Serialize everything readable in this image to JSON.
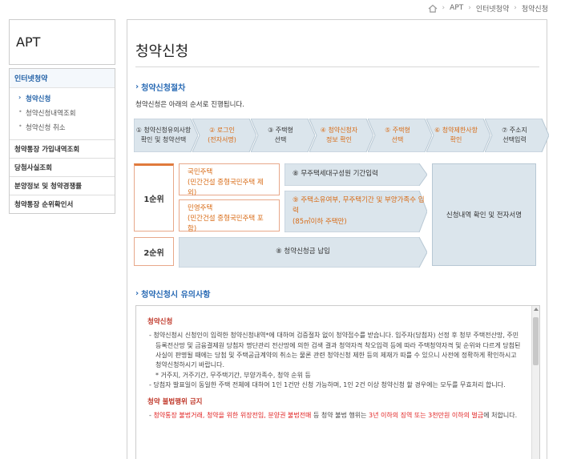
{
  "breadcrumb": {
    "items": [
      "APT",
      "인터넷청약",
      "청약신청"
    ]
  },
  "sidebar": {
    "title": "APT",
    "group_head": "인터넷청약",
    "sub_items": [
      {
        "label": "청약신청",
        "active": true
      },
      {
        "label": "청약신청내역조회",
        "active": false
      },
      {
        "label": "청약신청 취소",
        "active": false
      }
    ],
    "items": [
      "청약통장 가입내역조회",
      "당첨사실조회",
      "분양정보 및 청약경쟁률",
      "청약통장 순위확인서"
    ]
  },
  "main": {
    "title": "청약신청",
    "procedure_heading": "청약신청절차",
    "intro": "청약신청은 아래의 순서로 진행됩니다.",
    "steps": [
      {
        "line1": "① 청약신청유의사항",
        "line2": "확인 및 청약선택",
        "style": "gray"
      },
      {
        "line1": "② 로그인",
        "line2": "(전자서명)",
        "style": "orange"
      },
      {
        "line1": "③ 주택형",
        "line2": "선택",
        "style": "gray"
      },
      {
        "line1": "④ 청약신청자",
        "line2": "정보 확인",
        "style": "orange"
      },
      {
        "line1": "⑤ 주택형",
        "line2": "선택",
        "style": "orange"
      },
      {
        "line1": "⑥ 청약제한사항",
        "line2": "확인",
        "style": "orange"
      },
      {
        "line1": "⑦ 주소지",
        "line2": "선택입력",
        "style": "gray"
      }
    ],
    "flow": {
      "rank1": "1순위",
      "rank2": "2순위",
      "national_line1": "국민주택",
      "national_line2": "(민간건설 중형국민주택 제외)",
      "private_line1": "민영주택",
      "private_line2": "(민간건설 중형국민주택 포함)",
      "step8": "⑧ 무주택세대구성원 기간입력",
      "step9_line1": "⑨ 주택소유여부, 무주택기간 및 부양가족수 입력",
      "step9_line2": "(85㎡이하 주택만)",
      "step_payment": "⑧ 청약신청금 납입",
      "final": "신청내역 확인 및 전자서명"
    },
    "notice_heading": "청약신청시 유의사항",
    "notice": {
      "h1": "청약신청",
      "p1": "- 청약신청시 신청인이 입력한 청약신청내역*에 대하여 검증절차 없이 청약접수를 받습니다. 입주자(당첨자) 선정 후 청부 주택전산망, 주민등록전산망 및 금융결제원 당첨자 명단관리 전산망에 의한 검색 결과 청약자격 착오입력 등에 따라 주택청약자격 및 순위와 다르게 당첨된 사실이 판명될 때에는 당첨 및 주택공급계약의 취소는 물론 관련 청약신청 제한 등의 제재가 따를 수 있으니 사전에 정확하게 확인하시고 청약신청하시기 바랍니다.",
      "p1_sub": "* 거주지, 거주기간, 무주택기간, 부양가족수, 청약 순위 등",
      "p2": "- 당첨자 발표일이 동일한 주택 전체에 대하여 1인 1건만 신청 가능하며, 1인 2건 이상 청약신청 할 경우에는 모두를 무효처리 합니다.",
      "h2": "청약 불법행위 금지",
      "p3_red1": "청약통장 불법거래, 청약을 위한 위장전입, 분양권 불법전매",
      "p3_mid": " 등 청약 불법 행위는 ",
      "p3_red2": "3년 이하의 징역 또는 3천만원 이하의 벌금",
      "p3_end": "에 처합니다."
    }
  },
  "colors": {
    "accent_blue": "#2a6bb5",
    "accent_orange": "#d86a14",
    "step_fill": "#dbe5ec",
    "notice_red": "#e02020"
  }
}
